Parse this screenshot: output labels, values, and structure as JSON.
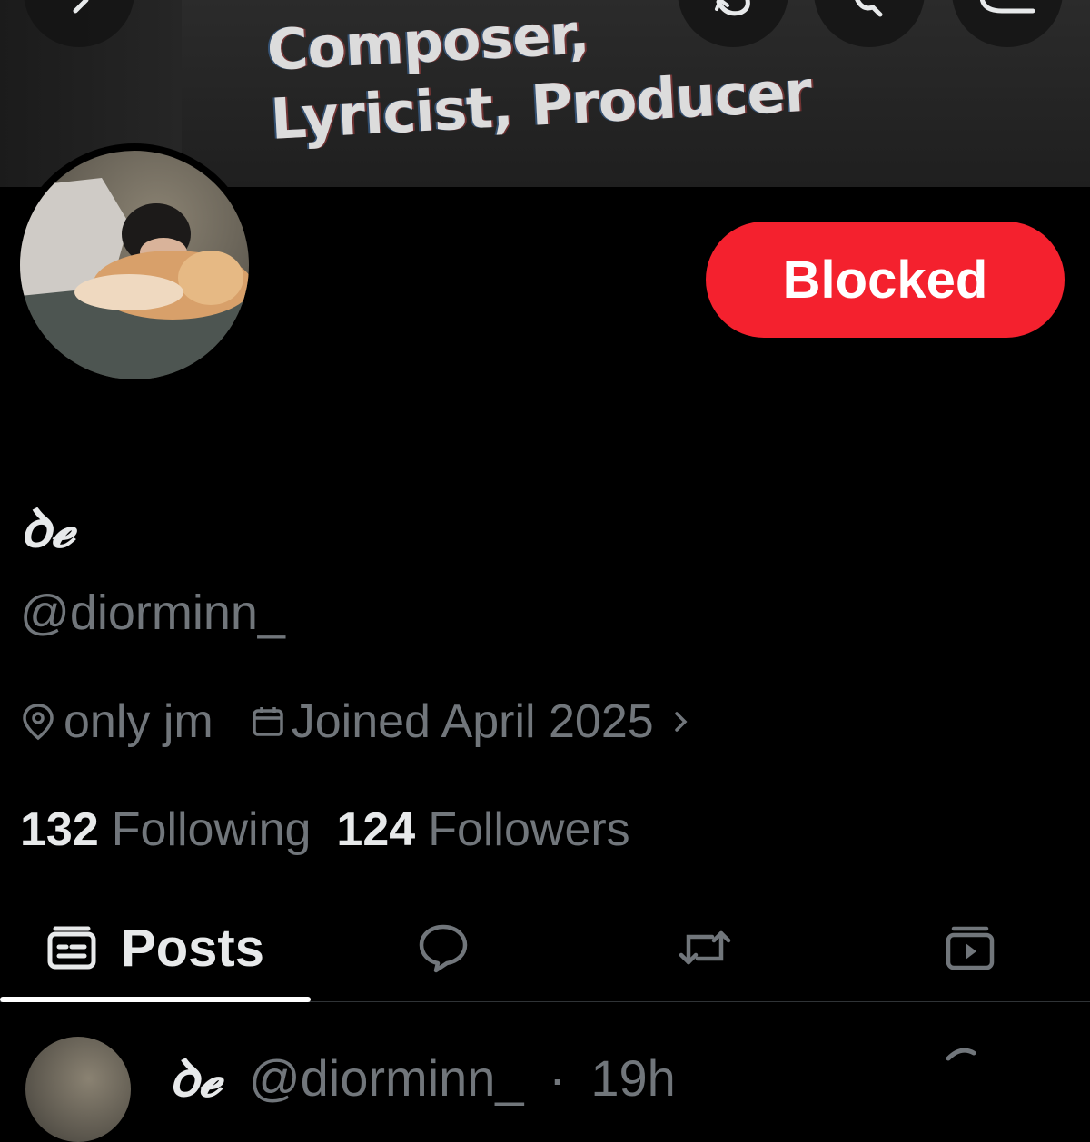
{
  "banner": {
    "text": "Composer,\nLyricist, Producer"
  },
  "header_icons": [
    "back-icon",
    "refresh-icon",
    "search-icon",
    "more-icon"
  ],
  "profile": {
    "display_name": "ꝺ𝓮",
    "handle": "@diorminn_",
    "location": "only jm",
    "joined": "Joined April 2025",
    "following_count": "132",
    "following_label": "Following",
    "followers_count": "124",
    "followers_label": "Followers"
  },
  "action": {
    "blocked_label": "Blocked",
    "color": "#f4212e"
  },
  "tabs": {
    "posts_label": "Posts",
    "icons": [
      "posts-icon",
      "replies-icon",
      "reposts-icon",
      "media-icon"
    ]
  },
  "post_preview": {
    "name": "ꝺ𝓮",
    "handle": "@diorminn_",
    "time": "19h"
  },
  "colors": {
    "background": "#000000",
    "primary_text": "#e7e9ea",
    "secondary_text": "#71767b",
    "divider": "#2f3336"
  }
}
